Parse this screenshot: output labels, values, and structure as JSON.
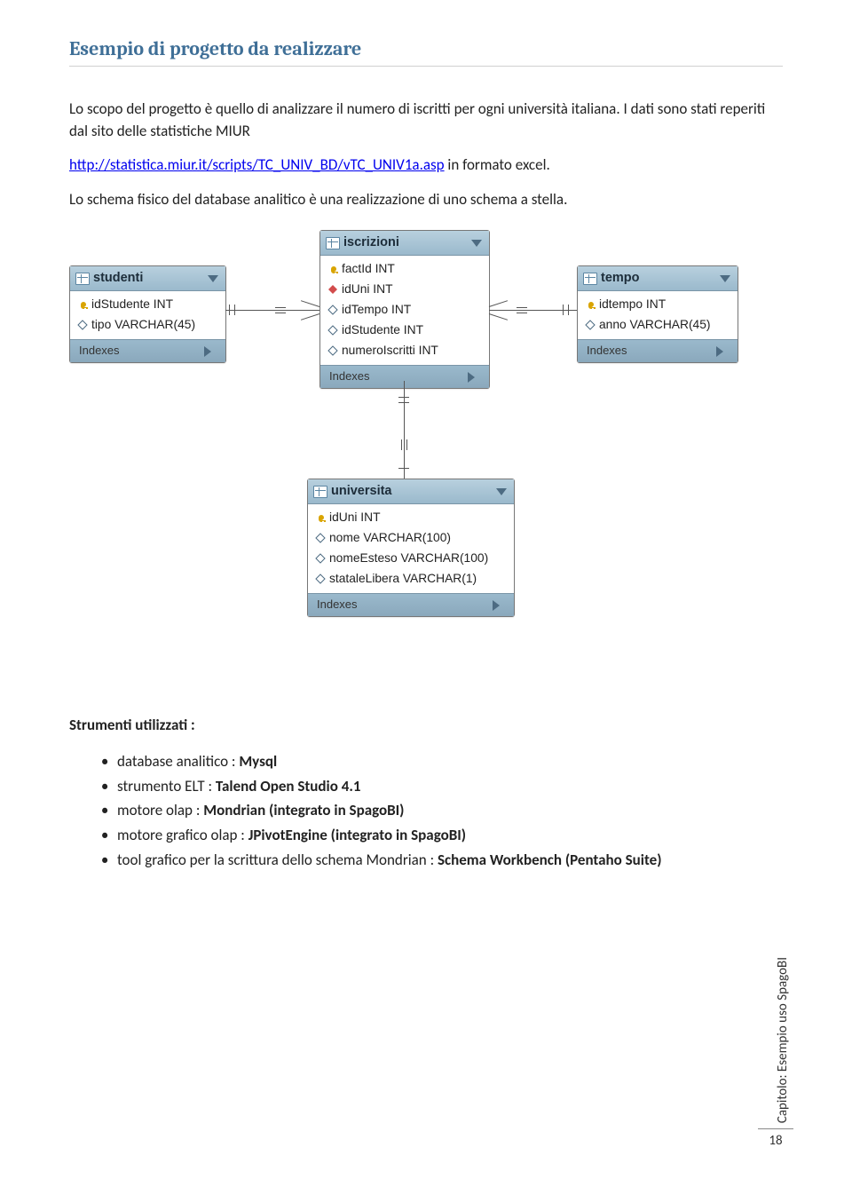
{
  "section_title": "Esempio di progetto da realizzare",
  "p1_a": "Lo scopo del progetto è quello di analizzare il numero di iscritti per ogni università italiana. I dati sono stati reperiti dal sito delle statistiche MIUR",
  "link": "http://statistica.miur.it/scripts/TC_UNIV_BD/vTC_UNIV1a.asp",
  "p1_c": " in formato excel.",
  "p2": "Lo schema fisico del database analitico è una realizzazione di uno schema a stella.",
  "tables": {
    "studenti": {
      "title": "studenti",
      "rows": [
        "idStudente INT",
        "tipo VARCHAR(45)"
      ],
      "kinds": [
        "key",
        "diamond"
      ],
      "footer": "Indexes"
    },
    "iscrizioni": {
      "title": "iscrizioni",
      "rows": [
        "factId INT",
        "idUni INT",
        "idTempo INT",
        "idStudente INT",
        "numeroIscritti INT"
      ],
      "kinds": [
        "key",
        "red",
        "blue",
        "blue",
        "blue"
      ],
      "footer": "Indexes"
    },
    "tempo": {
      "title": "tempo",
      "rows": [
        "idtempo INT",
        "anno VARCHAR(45)"
      ],
      "kinds": [
        "key",
        "diamond"
      ],
      "footer": "Indexes"
    },
    "universita": {
      "title": "universita",
      "rows": [
        "idUni INT",
        "nome VARCHAR(100)",
        "nomeEsteso VARCHAR(100)",
        "stataleLibera VARCHAR(1)"
      ],
      "kinds": [
        "key",
        "blue",
        "blue",
        "blue"
      ],
      "footer": "Indexes"
    }
  },
  "strumenti_header": "Strumenti utilizzati  :",
  "tools": [
    {
      "lead": "database analitico : ",
      "bold": "Mysql",
      "tail": ""
    },
    {
      "lead": "strumento ELT : ",
      "bold": "Talend Open Studio 4.1",
      "tail": ""
    },
    {
      "lead": "motore olap : ",
      "bold": "Mondrian (integrato in SpagoBI)",
      "tail": ""
    },
    {
      "lead": "motore grafico olap : ",
      "bold": "JPivotEngine (integrato in SpagoBI)",
      "tail": ""
    },
    {
      "lead": "tool grafico per la scrittura dello schema Mondrian : ",
      "bold": "Schema Workbench (Pentaho Suite)",
      "tail": ""
    }
  ],
  "footer_caption": "Capitolo: Esempio uso SpagoBI",
  "page_number": "18"
}
